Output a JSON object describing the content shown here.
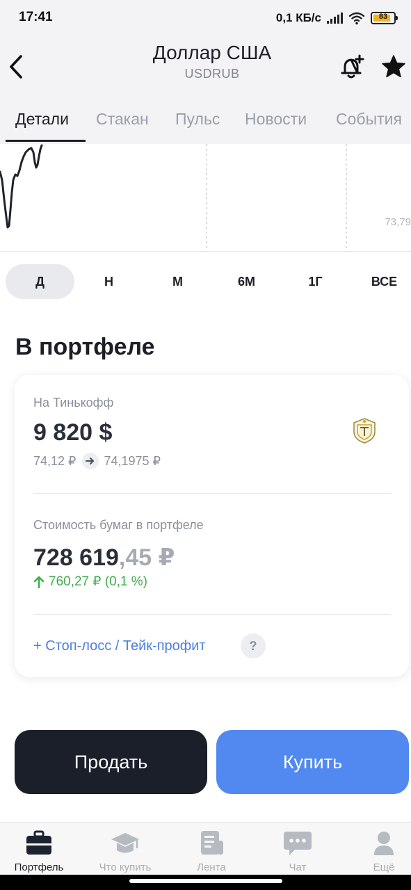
{
  "status_bar": {
    "time": "17:41",
    "speed": "0,1 КБ/с",
    "battery": "83"
  },
  "header": {
    "title": "Доллар США",
    "subtitle": "USDRUB"
  },
  "tabs": [
    {
      "label": "Детали",
      "active": true
    },
    {
      "label": "Стакан",
      "active": false
    },
    {
      "label": "Пульс",
      "active": false
    },
    {
      "label": "Новости",
      "active": false
    },
    {
      "label": "События",
      "active": false
    }
  ],
  "chart": {
    "price_label": "73,79"
  },
  "periods": [
    {
      "label": "Д",
      "active": true
    },
    {
      "label": "Н",
      "active": false
    },
    {
      "label": "М",
      "active": false
    },
    {
      "label": "6М",
      "active": false
    },
    {
      "label": "1Г",
      "active": false
    },
    {
      "label": "ВСЕ",
      "active": false
    }
  ],
  "portfolio": {
    "section_title": "В портфеле",
    "broker_label": "На Тинькофф",
    "amount": "9 820 $",
    "rate_from": "74,12 ₽",
    "rate_to": "74,1975 ₽",
    "value_label": "Стоимость бумаг в портфеле",
    "value_main": "728 619",
    "value_fraction": ",45 ₽",
    "change": "760,27 ₽ (0,1 %)",
    "stoploss_link": "+ Стоп-лосс / Тейк-профит",
    "help": "?"
  },
  "actions": {
    "sell": "Продать",
    "buy": "Купить"
  },
  "bottom_nav": [
    {
      "label": "Портфель",
      "icon": "briefcase-icon",
      "active": true
    },
    {
      "label": "Что купить",
      "icon": "graduation-cap-icon",
      "active": false
    },
    {
      "label": "Лента",
      "icon": "feed-icon",
      "active": false
    },
    {
      "label": "Чат",
      "icon": "chat-icon",
      "active": false
    },
    {
      "label": "Ещё",
      "icon": "profile-icon",
      "active": false
    }
  ],
  "colors": {
    "accent_blue": "#5189f1",
    "dark_button": "#1b1f2a",
    "positive_green": "#3fae4f",
    "battery_yellow": "#f2b21a"
  }
}
